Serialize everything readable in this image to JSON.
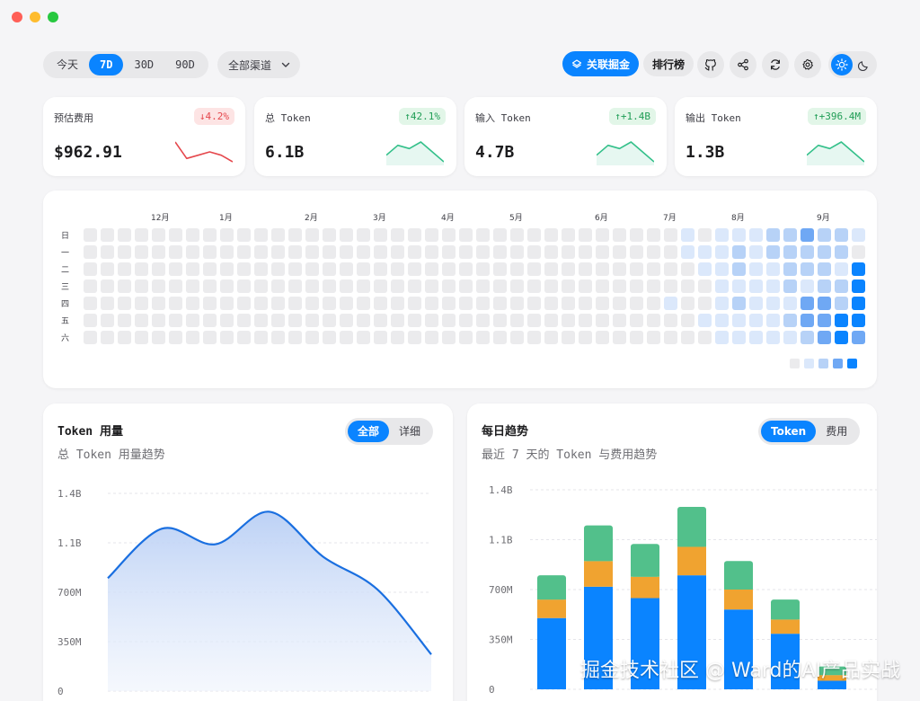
{
  "window": {
    "controls": [
      "close",
      "minimize",
      "maximize"
    ]
  },
  "toolbar": {
    "range_options": [
      "今天",
      "7D",
      "30D",
      "90D"
    ],
    "range_selected": "7D",
    "channel_select": "全部渠道",
    "link_button": "关联掘金",
    "leaderboard_button": "排行榜",
    "icons": [
      "github-icon",
      "share-icon",
      "refresh-icon",
      "settings-icon"
    ],
    "theme": {
      "options": [
        "sun-icon",
        "moon-icon"
      ],
      "selected": "light"
    }
  },
  "stats": [
    {
      "label": "预估费用",
      "value": "$962.91",
      "change": "↓4.2%",
      "trend": "down",
      "color": "#e5484d",
      "spark": [
        7,
        2,
        3,
        4,
        3,
        1
      ]
    },
    {
      "label": "总 Token",
      "value": "6.1B",
      "change": "↑42.1%",
      "trend": "up",
      "color": "#34c08a",
      "spark": [
        3,
        6,
        5,
        7,
        4,
        1
      ]
    },
    {
      "label": "输入 Token",
      "value": "4.7B",
      "change": "↑+1.4B",
      "trend": "up",
      "color": "#34c08a",
      "spark": [
        3,
        6,
        5,
        7,
        4,
        1
      ]
    },
    {
      "label": "输出 Token",
      "value": "1.3B",
      "change": "↑+396.4M",
      "trend": "up",
      "color": "#34c08a",
      "spark": [
        3,
        6,
        5,
        7,
        4,
        1
      ]
    }
  ],
  "heatmap": {
    "months": [
      "12月",
      "1月",
      "2月",
      "3月",
      "4月",
      "5月",
      "6月",
      "7月",
      "8月",
      "9月"
    ],
    "weekdays": [
      "日",
      "一",
      "二",
      "三",
      "四",
      "五",
      "六"
    ],
    "levels": [
      "0000000000000000000000000000000000000000000000000000000000000000000000000000000000000000000000000000000000000000000000000000000000000000000000000000000000000000000000000000000000000000000000000000000001000000000000000000000000000000000000000000000000000000000000",
      "00000000000000000000000000000000000000000000000000000000000000000000000000000000000000000000000000000000000000000000000000000000000000000000000000000000000000000000000000000000000000000000000000000010000000000000000000000000000000000000000000000000000000000000"
    ],
    "grid": [
      [
        0,
        0,
        0,
        0,
        0,
        0,
        0,
        0,
        0,
        0,
        0,
        0,
        0,
        0,
        0,
        0,
        0,
        0,
        0,
        0,
        0,
        0,
        0,
        0,
        0,
        0,
        0,
        0,
        0,
        0,
        0,
        0,
        0,
        0,
        0,
        1,
        0,
        1,
        1,
        1,
        2,
        2,
        3,
        2,
        2,
        1
      ],
      [
        0,
        0,
        0,
        0,
        0,
        0,
        0,
        0,
        0,
        0,
        0,
        0,
        0,
        0,
        0,
        0,
        0,
        0,
        0,
        0,
        0,
        0,
        0,
        0,
        0,
        0,
        0,
        0,
        0,
        0,
        0,
        0,
        0,
        0,
        0,
        1,
        1,
        1,
        2,
        1,
        2,
        2,
        2,
        2,
        2,
        0
      ],
      [
        0,
        0,
        0,
        0,
        0,
        0,
        0,
        0,
        0,
        0,
        0,
        0,
        0,
        0,
        0,
        0,
        0,
        0,
        0,
        0,
        0,
        0,
        0,
        0,
        0,
        0,
        0,
        0,
        0,
        0,
        0,
        0,
        0,
        0,
        0,
        0,
        1,
        1,
        2,
        1,
        1,
        2,
        2,
        2,
        1,
        4
      ],
      [
        0,
        0,
        0,
        0,
        0,
        0,
        0,
        0,
        0,
        0,
        0,
        0,
        0,
        0,
        0,
        0,
        0,
        0,
        0,
        0,
        0,
        0,
        0,
        0,
        0,
        0,
        0,
        0,
        0,
        0,
        0,
        0,
        0,
        0,
        0,
        0,
        0,
        1,
        1,
        1,
        1,
        2,
        1,
        2,
        2,
        4
      ],
      [
        0,
        0,
        0,
        0,
        0,
        0,
        0,
        0,
        0,
        0,
        0,
        0,
        0,
        0,
        0,
        0,
        0,
        0,
        0,
        0,
        0,
        0,
        0,
        0,
        0,
        0,
        0,
        0,
        0,
        0,
        0,
        0,
        0,
        0,
        1,
        0,
        0,
        1,
        2,
        1,
        1,
        1,
        3,
        3,
        2,
        4
      ],
      [
        0,
        0,
        0,
        0,
        0,
        0,
        0,
        0,
        0,
        0,
        0,
        0,
        0,
        0,
        0,
        0,
        0,
        0,
        0,
        0,
        0,
        0,
        0,
        0,
        0,
        0,
        0,
        0,
        0,
        0,
        0,
        0,
        0,
        0,
        0,
        0,
        1,
        1,
        1,
        1,
        1,
        2,
        3,
        3,
        4,
        4
      ],
      [
        0,
        0,
        0,
        0,
        0,
        0,
        0,
        0,
        0,
        0,
        0,
        0,
        0,
        0,
        0,
        0,
        0,
        0,
        0,
        0,
        0,
        0,
        0,
        0,
        0,
        0,
        0,
        0,
        0,
        0,
        0,
        0,
        0,
        0,
        0,
        0,
        0,
        1,
        1,
        1,
        1,
        1,
        2,
        3,
        4,
        3
      ]
    ],
    "colors": [
      "#ebebed",
      "#dbe8fb",
      "#b7d2f7",
      "#6fa8f4",
      "#0a84ff"
    ],
    "legend": [
      0,
      1,
      2,
      3,
      4
    ]
  },
  "token_panel": {
    "title": "Token 用量",
    "subtitle": "总 Token 用量趋势",
    "tabs": [
      "全部",
      "详细"
    ],
    "tab_selected": "全部"
  },
  "daily_panel": {
    "title": "每日趋势",
    "subtitle": "最近 7 天的 Token 与费用趋势",
    "tabs": [
      "Token",
      "费用"
    ],
    "tab_selected": "Token"
  },
  "chart_data": [
    {
      "type": "area",
      "yticks": [
        "1.4B",
        "1.1B",
        "700M",
        "350M",
        "0"
      ],
      "ylim": [
        0,
        1400000000
      ],
      "series": [
        {
          "values": [
            800000000,
            1150000000,
            1040000000,
            1270000000,
            950000000,
            720000000,
            260000000
          ]
        }
      ],
      "color": "#1a6fe0"
    },
    {
      "type": "bar",
      "stacked": true,
      "yticks": [
        "1.4B",
        "1.1B",
        "700M",
        "350M",
        "0"
      ],
      "ylim": [
        0,
        1400000000
      ],
      "series": [
        {
          "values": [
            500000000,
            720000000,
            640000000,
            800000000,
            560000000,
            390000000,
            60000000
          ],
          "color": "#0a84ff"
        },
        {
          "values": [
            130000000,
            180000000,
            150000000,
            200000000,
            140000000,
            100000000,
            40000000
          ],
          "color": "#f0a330"
        },
        {
          "values": [
            170000000,
            250000000,
            230000000,
            280000000,
            200000000,
            140000000,
            60000000
          ],
          "color": "#52c08b"
        }
      ]
    }
  ],
  "watermark": "掘金技术社区 @ Ward的AI产品实战"
}
